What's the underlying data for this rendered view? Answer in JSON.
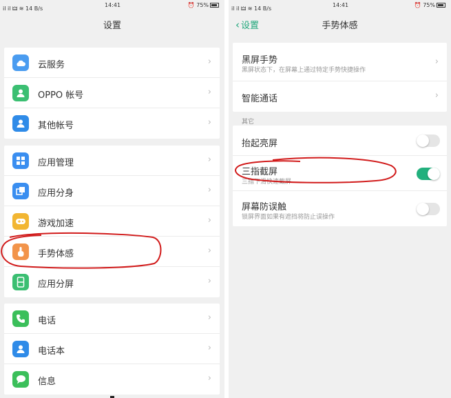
{
  "colors": {
    "accent_green": "#22b07d",
    "back_green": "#1fa67a",
    "annotation_red": "#d11a1a",
    "background": "#f0f0f0"
  },
  "left": {
    "status": {
      "signal": "il il 🜲 ≋ 14 B/s",
      "time": "14:41",
      "battery": "75%"
    },
    "title": "设置",
    "groups": [
      {
        "items": [
          {
            "icon": "cloud-icon",
            "icon_color": "#4a9cf0",
            "label": "云服务"
          },
          {
            "icon": "person-icon",
            "icon_color": "#3bbf72",
            "label": "OPPO 帐号"
          },
          {
            "icon": "account-icon",
            "icon_color": "#2f8be8",
            "label": "其他帐号"
          }
        ]
      },
      {
        "items": [
          {
            "icon": "app-grid-icon",
            "icon_color": "#3a8ef0",
            "label": "应用管理"
          },
          {
            "icon": "clone-icon",
            "icon_color": "#3a8ef0",
            "label": "应用分身"
          },
          {
            "icon": "gamepad-icon",
            "icon_color": "#f2b632",
            "label": "游戏加速"
          },
          {
            "icon": "hand-gesture-icon",
            "icon_color": "#f2944a",
            "label": "手势体感"
          },
          {
            "icon": "split-screen-icon",
            "icon_color": "#3bbf72",
            "label": "应用分屏"
          }
        ]
      },
      {
        "items": [
          {
            "icon": "phone-icon",
            "icon_color": "#3bbf5a",
            "label": "电话"
          },
          {
            "icon": "contacts-icon",
            "icon_color": "#2f8be8",
            "label": "电话本"
          },
          {
            "icon": "message-icon",
            "icon_color": "#3bbf5a",
            "label": "信息"
          }
        ]
      }
    ]
  },
  "right": {
    "status": {
      "signal": "il il 🜲 ≋ 14 B/s",
      "time": "14:41",
      "battery": "75%"
    },
    "back_label": "设置",
    "title": "手势体感",
    "top_items": [
      {
        "label": "黑屏手势",
        "sub": "黑屏状态下，在屏幕上通过特定手势快捷操作"
      },
      {
        "label": "智能通话",
        "sub": ""
      }
    ],
    "section_label": "其它",
    "toggles": [
      {
        "label": "抬起亮屏",
        "sub": "",
        "on": false
      },
      {
        "label": "三指截屏",
        "sub": "三指下滑快速截屏",
        "on": true
      },
      {
        "label": "屏幕防误触",
        "sub": "锁屏界面如果有遮挡将防止误操作",
        "on": false
      }
    ]
  }
}
